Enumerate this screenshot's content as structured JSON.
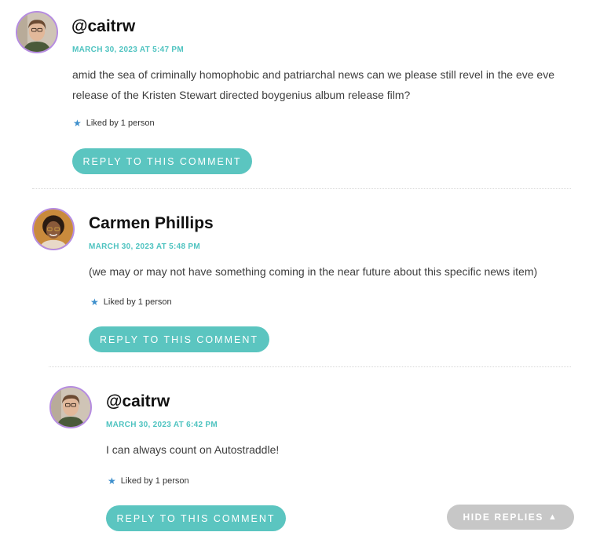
{
  "comments": [
    {
      "author": "@caitrw",
      "date": "MARCH 30, 2023 AT 5:47 PM",
      "body": "amid the sea of criminally homophobic and patriarchal news can we please still revel in the eve eve release of the Kristen Stewart directed boygenius album release film?",
      "likes": "Liked by 1 person",
      "reply_label": "REPLY TO THIS COMMENT"
    },
    {
      "author": "Carmen Phillips",
      "date": "MARCH 30, 2023 AT 5:48 PM",
      "body": "(we may or may not have something coming in the near future about this specific news item)",
      "likes": "Liked by 1 person",
      "reply_label": "REPLY TO THIS COMMENT"
    },
    {
      "author": "@caitrw",
      "date": "MARCH 30, 2023 AT 6:42 PM",
      "body": "I can always count on Autostraddle!",
      "likes": "Liked by 1 person",
      "reply_label": "REPLY TO THIS COMMENT"
    }
  ],
  "hide_replies_label": "HIDE REPLIES",
  "icons": {
    "like": "star-icon",
    "hide": "triangle-up-icon"
  },
  "colors": {
    "accent": "#5bc5c0",
    "date": "#4ec3c0",
    "avatar_border": "#b58be0",
    "hide_button": "#c7c7c7",
    "star": "#3d8fcc"
  }
}
